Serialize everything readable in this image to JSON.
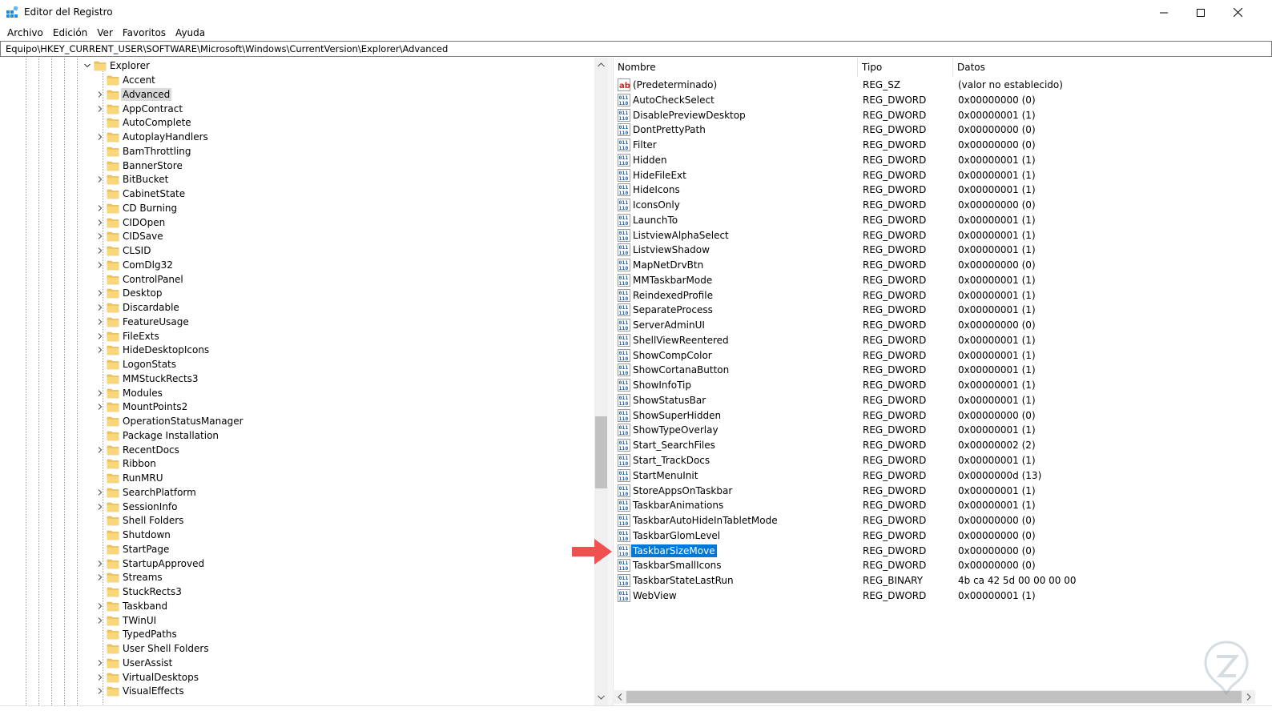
{
  "window": {
    "title": "Editor del Registro"
  },
  "menu": [
    "Archivo",
    "Edición",
    "Ver",
    "Favoritos",
    "Ayuda"
  ],
  "address": "Equipo\\HKEY_CURRENT_USER\\SOFTWARE\\Microsoft\\Windows\\CurrentVersion\\Explorer\\Advanced",
  "tree": {
    "parent": "Explorer",
    "selected": "Advanced",
    "keys": [
      {
        "name": "Accent",
        "expandable": false
      },
      {
        "name": "Advanced",
        "expandable": true
      },
      {
        "name": "AppContract",
        "expandable": true
      },
      {
        "name": "AutoComplete",
        "expandable": false
      },
      {
        "name": "AutoplayHandlers",
        "expandable": true
      },
      {
        "name": "BamThrottling",
        "expandable": false
      },
      {
        "name": "BannerStore",
        "expandable": false
      },
      {
        "name": "BitBucket",
        "expandable": true
      },
      {
        "name": "CabinetState",
        "expandable": false
      },
      {
        "name": "CD Burning",
        "expandable": true
      },
      {
        "name": "CIDOpen",
        "expandable": true
      },
      {
        "name": "CIDSave",
        "expandable": true
      },
      {
        "name": "CLSID",
        "expandable": true
      },
      {
        "name": "ComDlg32",
        "expandable": true
      },
      {
        "name": "ControlPanel",
        "expandable": false
      },
      {
        "name": "Desktop",
        "expandable": true
      },
      {
        "name": "Discardable",
        "expandable": true
      },
      {
        "name": "FeatureUsage",
        "expandable": true
      },
      {
        "name": "FileExts",
        "expandable": true
      },
      {
        "name": "HideDesktopIcons",
        "expandable": true
      },
      {
        "name": "LogonStats",
        "expandable": false
      },
      {
        "name": "MMStuckRects3",
        "expandable": false
      },
      {
        "name": "Modules",
        "expandable": true
      },
      {
        "name": "MountPoints2",
        "expandable": true
      },
      {
        "name": "OperationStatusManager",
        "expandable": false
      },
      {
        "name": "Package Installation",
        "expandable": false
      },
      {
        "name": "RecentDocs",
        "expandable": true
      },
      {
        "name": "Ribbon",
        "expandable": false
      },
      {
        "name": "RunMRU",
        "expandable": false
      },
      {
        "name": "SearchPlatform",
        "expandable": true
      },
      {
        "name": "SessionInfo",
        "expandable": true
      },
      {
        "name": "Shell Folders",
        "expandable": false
      },
      {
        "name": "Shutdown",
        "expandable": false
      },
      {
        "name": "StartPage",
        "expandable": false
      },
      {
        "name": "StartupApproved",
        "expandable": true
      },
      {
        "name": "Streams",
        "expandable": true
      },
      {
        "name": "StuckRects3",
        "expandable": false
      },
      {
        "name": "Taskband",
        "expandable": true
      },
      {
        "name": "TWinUI",
        "expandable": true
      },
      {
        "name": "TypedPaths",
        "expandable": false
      },
      {
        "name": "User Shell Folders",
        "expandable": false
      },
      {
        "name": "UserAssist",
        "expandable": true
      },
      {
        "name": "VirtualDesktops",
        "expandable": true
      },
      {
        "name": "VisualEffects",
        "expandable": true
      }
    ]
  },
  "values": {
    "headers": {
      "name": "Nombre",
      "type": "Tipo",
      "data": "Datos"
    },
    "selected": "TaskbarSizeMove",
    "rows": [
      {
        "name": "(Predeterminado)",
        "type": "REG_SZ",
        "data": "(valor no establecido)",
        "icon": "string-value-icon"
      },
      {
        "name": "AutoCheckSelect",
        "type": "REG_DWORD",
        "data": "0x00000000 (0)",
        "icon": "binary-value-icon"
      },
      {
        "name": "DisablePreviewDesktop",
        "type": "REG_DWORD",
        "data": "0x00000001 (1)",
        "icon": "binary-value-icon"
      },
      {
        "name": "DontPrettyPath",
        "type": "REG_DWORD",
        "data": "0x00000000 (0)",
        "icon": "binary-value-icon"
      },
      {
        "name": "Filter",
        "type": "REG_DWORD",
        "data": "0x00000000 (0)",
        "icon": "binary-value-icon"
      },
      {
        "name": "Hidden",
        "type": "REG_DWORD",
        "data": "0x00000001 (1)",
        "icon": "binary-value-icon"
      },
      {
        "name": "HideFileExt",
        "type": "REG_DWORD",
        "data": "0x00000001 (1)",
        "icon": "binary-value-icon"
      },
      {
        "name": "HideIcons",
        "type": "REG_DWORD",
        "data": "0x00000001 (1)",
        "icon": "binary-value-icon"
      },
      {
        "name": "IconsOnly",
        "type": "REG_DWORD",
        "data": "0x00000000 (0)",
        "icon": "binary-value-icon"
      },
      {
        "name": "LaunchTo",
        "type": "REG_DWORD",
        "data": "0x00000001 (1)",
        "icon": "binary-value-icon"
      },
      {
        "name": "ListviewAlphaSelect",
        "type": "REG_DWORD",
        "data": "0x00000001 (1)",
        "icon": "binary-value-icon"
      },
      {
        "name": "ListviewShadow",
        "type": "REG_DWORD",
        "data": "0x00000001 (1)",
        "icon": "binary-value-icon"
      },
      {
        "name": "MapNetDrvBtn",
        "type": "REG_DWORD",
        "data": "0x00000000 (0)",
        "icon": "binary-value-icon"
      },
      {
        "name": "MMTaskbarMode",
        "type": "REG_DWORD",
        "data": "0x00000001 (1)",
        "icon": "binary-value-icon"
      },
      {
        "name": "ReindexedProfile",
        "type": "REG_DWORD",
        "data": "0x00000001 (1)",
        "icon": "binary-value-icon"
      },
      {
        "name": "SeparateProcess",
        "type": "REG_DWORD",
        "data": "0x00000001 (1)",
        "icon": "binary-value-icon"
      },
      {
        "name": "ServerAdminUI",
        "type": "REG_DWORD",
        "data": "0x00000000 (0)",
        "icon": "binary-value-icon"
      },
      {
        "name": "ShellViewReentered",
        "type": "REG_DWORD",
        "data": "0x00000001 (1)",
        "icon": "binary-value-icon"
      },
      {
        "name": "ShowCompColor",
        "type": "REG_DWORD",
        "data": "0x00000001 (1)",
        "icon": "binary-value-icon"
      },
      {
        "name": "ShowCortanaButton",
        "type": "REG_DWORD",
        "data": "0x00000001 (1)",
        "icon": "binary-value-icon"
      },
      {
        "name": "ShowInfoTip",
        "type": "REG_DWORD",
        "data": "0x00000001 (1)",
        "icon": "binary-value-icon"
      },
      {
        "name": "ShowStatusBar",
        "type": "REG_DWORD",
        "data": "0x00000001 (1)",
        "icon": "binary-value-icon"
      },
      {
        "name": "ShowSuperHidden",
        "type": "REG_DWORD",
        "data": "0x00000000 (0)",
        "icon": "binary-value-icon"
      },
      {
        "name": "ShowTypeOverlay",
        "type": "REG_DWORD",
        "data": "0x00000001 (1)",
        "icon": "binary-value-icon"
      },
      {
        "name": "Start_SearchFiles",
        "type": "REG_DWORD",
        "data": "0x00000002 (2)",
        "icon": "binary-value-icon"
      },
      {
        "name": "Start_TrackDocs",
        "type": "REG_DWORD",
        "data": "0x00000001 (1)",
        "icon": "binary-value-icon"
      },
      {
        "name": "StartMenuInit",
        "type": "REG_DWORD",
        "data": "0x0000000d (13)",
        "icon": "binary-value-icon"
      },
      {
        "name": "StoreAppsOnTaskbar",
        "type": "REG_DWORD",
        "data": "0x00000001 (1)",
        "icon": "binary-value-icon"
      },
      {
        "name": "TaskbarAnimations",
        "type": "REG_DWORD",
        "data": "0x00000001 (1)",
        "icon": "binary-value-icon"
      },
      {
        "name": "TaskbarAutoHideInTabletMode",
        "type": "REG_DWORD",
        "data": "0x00000000 (0)",
        "icon": "binary-value-icon"
      },
      {
        "name": "TaskbarGlomLevel",
        "type": "REG_DWORD",
        "data": "0x00000000 (0)",
        "icon": "binary-value-icon"
      },
      {
        "name": "TaskbarSizeMove",
        "type": "REG_DWORD",
        "data": "0x00000000 (0)",
        "icon": "binary-value-icon"
      },
      {
        "name": "TaskbarSmallIcons",
        "type": "REG_DWORD",
        "data": "0x00000000 (0)",
        "icon": "binary-value-icon"
      },
      {
        "name": "TaskbarStateLastRun",
        "type": "REG_BINARY",
        "data": "4b ca 42 5d 00 00 00 00",
        "icon": "binary-value-icon"
      },
      {
        "name": "WebView",
        "type": "REG_DWORD",
        "data": "0x00000001 (1)",
        "icon": "binary-value-icon"
      }
    ]
  },
  "colors": {
    "selection": "#0078d7",
    "tree_selection": "#d9d9d9",
    "folder": "#f2c55c",
    "annotation_arrow": "#f0504f"
  }
}
